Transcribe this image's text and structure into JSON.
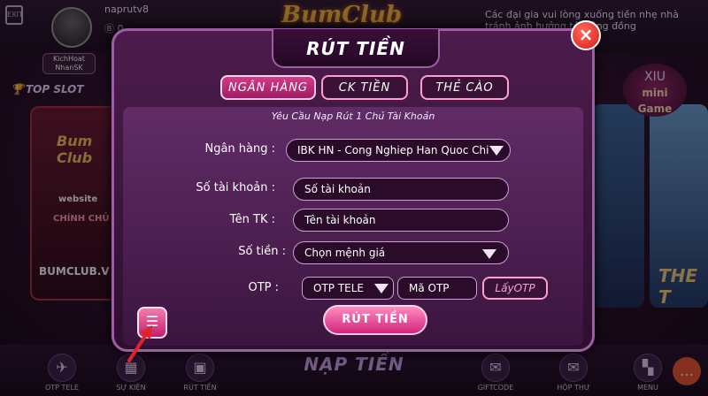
{
  "background": {
    "logout_label": "EXIT",
    "username": "naprutv8",
    "balance": "0",
    "vip_label": "KichHoat NhanSK",
    "top_slot": "TOP SLOT",
    "logo": "BumClub",
    "notice": "Các đại gia vui lòng xuống tiền nhẹ nhà tránh ảnh hưởng tới cộng đồng",
    "left_card": {
      "logo": "Bum Club",
      "website": "website",
      "official": "CHÍNH CHỦ",
      "url": "BUMCLUB.V"
    },
    "xiu": {
      "top": "XIU",
      "label": "mini Game"
    },
    "right_label": "THE T",
    "bottom_nav": [
      {
        "label": "OTP TELE",
        "icon": "telegram-icon",
        "glyph": "✈"
      },
      {
        "label": "SỰ KIỆN",
        "icon": "calendar-icon",
        "glyph": "▦"
      },
      {
        "label": "RÚT TIỀN",
        "icon": "withdraw-icon",
        "glyph": "▣"
      },
      {
        "label": "GIFTCODE",
        "icon": "gift-icon",
        "glyph": "✉"
      },
      {
        "label": "HỘP THƯ",
        "icon": "mail-icon",
        "glyph": "✉"
      },
      {
        "label": "MENU",
        "icon": "menu-icon",
        "glyph": "▚"
      }
    ],
    "nap_tien": "NẠP TIỀN",
    "chat_glyph": "…"
  },
  "dialog": {
    "title": "RÚT TIỀN",
    "close_glyph": "×",
    "tabs": [
      {
        "label": "NGÂN HÀNG",
        "active": true
      },
      {
        "label": "CK TIỀN",
        "active": false
      },
      {
        "label": "THẺ CÀO",
        "active": false
      }
    ],
    "panel_heading": "Yêu Cầu Nạp Rút 1 Chủ Tài Khoản",
    "form": {
      "bank_label": "Ngân hàng :",
      "bank_value": "IBK HN - Cong Nghiep Han Quoc Chi",
      "account_label": "Số tài khoản :",
      "account_placeholder": "Số tài khoản",
      "name_label": "Tên TK :",
      "name_placeholder": "Tên tài khoản",
      "amount_label": "Số tiền :",
      "amount_value": "Chọn mệnh giá",
      "otp_label": "OTP :",
      "otp_method": "OTP TELE",
      "otp_placeholder": "Mã OTP",
      "get_otp": "LấyOTP"
    },
    "submit": "RÚT TIỀN",
    "history_glyph": "☰"
  },
  "colors": {
    "accent_pink": "#d23b8a",
    "close_red": "#d61c18",
    "border_purple": "#9b5ea3",
    "arrow_red": "#e0222a"
  }
}
